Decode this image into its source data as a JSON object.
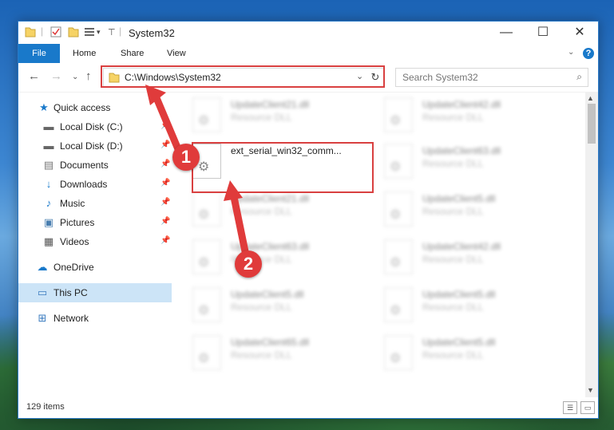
{
  "window": {
    "title": "System32",
    "controls": {
      "minimize": "—",
      "maximize": "☐",
      "close": "✕"
    }
  },
  "ribbon": {
    "tabs": [
      "File",
      "Home",
      "Share",
      "View"
    ],
    "help": "?"
  },
  "address_bar": {
    "path": "C:\\Windows\\System32",
    "search_placeholder": "Search System32"
  },
  "sidebar": {
    "items": [
      {
        "label": "Quick access",
        "icon": "star-icon"
      },
      {
        "label": "Local Disk (C:)",
        "icon": "drive-icon",
        "pinned": true
      },
      {
        "label": "Local Disk (D:)",
        "icon": "drive-icon",
        "pinned": true
      },
      {
        "label": "Documents",
        "icon": "documents-icon",
        "pinned": true
      },
      {
        "label": "Downloads",
        "icon": "download-icon",
        "pinned": true
      },
      {
        "label": "Music",
        "icon": "music-icon",
        "pinned": true
      },
      {
        "label": "Pictures",
        "icon": "pictures-icon",
        "pinned": true
      },
      {
        "label": "Videos",
        "icon": "videos-icon",
        "pinned": true
      },
      {
        "label": "OneDrive",
        "icon": "cloud-icon"
      },
      {
        "label": "This PC",
        "icon": "computer-icon",
        "selected": true
      },
      {
        "label": "Network",
        "icon": "network-icon"
      }
    ]
  },
  "files": {
    "left": [
      {
        "name": "UpdateClient21.dll",
        "type": "Resource DLL"
      },
      {
        "name": "ext_serial_win32_comm...",
        "type": ""
      },
      {
        "name": "UpdateClient21.dll",
        "type": "Resource DLL"
      },
      {
        "name": "UpdateClient63.dll",
        "type": "Resource DLL"
      },
      {
        "name": "UpdateClient5.dll",
        "type": "Resource DLL"
      },
      {
        "name": "UpdateClient65.dll",
        "type": "Resource DLL"
      }
    ],
    "right": [
      {
        "name": "UpdateClient42.dll",
        "type": "Resource DLL"
      },
      {
        "name": "UpdateClient63.dll",
        "type": "Resource DLL"
      },
      {
        "name": "UpdateClient5.dll",
        "type": "Resource DLL"
      },
      {
        "name": "UpdateClient42.dll",
        "type": "Resource DLL"
      },
      {
        "name": "UpdateClient5.dll",
        "type": "Resource DLL"
      },
      {
        "name": "UpdateClient5.dll",
        "type": "Resource DLL"
      }
    ]
  },
  "status": {
    "item_count": "129 items"
  },
  "callouts": [
    "1",
    "2"
  ],
  "colors": {
    "accent": "#1979ca",
    "highlight": "#d94040",
    "selected": "#cce4f7"
  }
}
